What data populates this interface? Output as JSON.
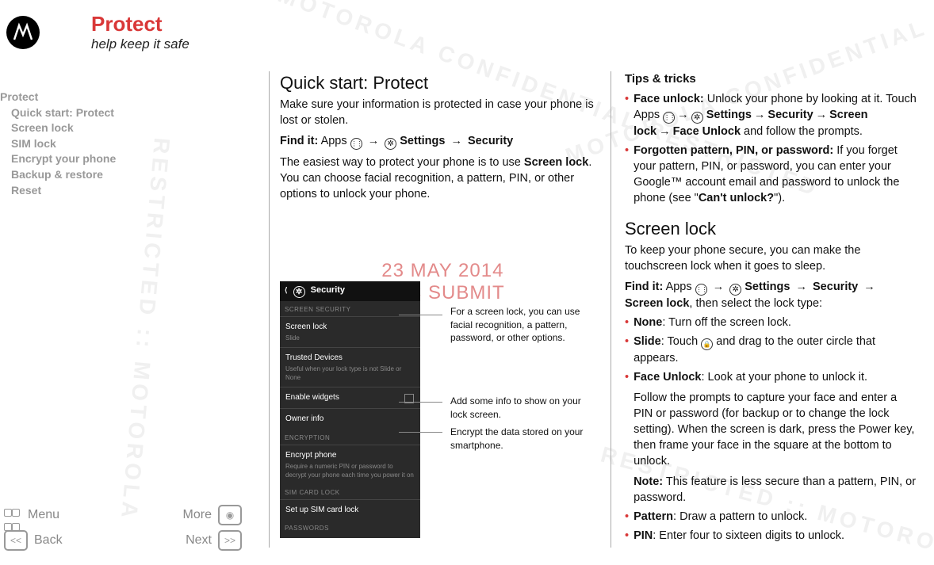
{
  "header": {
    "title": "Protect",
    "subtitle": "help keep it safe"
  },
  "toc": {
    "top": "Protect",
    "items": [
      "Quick start: Protect",
      "Screen lock",
      "SIM lock",
      "Encrypt your phone",
      "Backup & restore",
      "Reset"
    ]
  },
  "col1": {
    "heading": "Quick start: Protect",
    "intro": "Make sure your information is protected in case your phone is lost or stolen.",
    "findit_label": "Find it:",
    "findit_apps": "Apps",
    "findit_settings": "Settings",
    "findit_security": "Security",
    "body": "The easiest way to protect your phone is to use ",
    "screenlock_bold": "Screen lock",
    "body2": ". You can choose facial recognition, a pattern, PIN, or other options to unlock your phone."
  },
  "phone": {
    "title": "Security",
    "sec1": "SCREEN SECURITY",
    "item1": "Screen lock",
    "item1sub": "Slide",
    "item2": "Trusted Devices",
    "item2sub": "Useful when your lock type is not Slide or None",
    "item3": "Enable widgets",
    "item4": "Owner info",
    "sec2": "ENCRYPTION",
    "item5": "Encrypt phone",
    "item5sub": "Require a numeric PIN or password to decrypt your phone each time you power it on",
    "sec3": "SIM CARD LOCK",
    "item6": "Set up SIM card lock",
    "sec4": "PASSWORDS"
  },
  "callouts": {
    "c1": "For a screen lock, you can use facial recognition, a pattern, password, or other options.",
    "c2": "Add some info to show on your lock screen.",
    "c3": "Encrypt the data stored on your smartphone."
  },
  "col2": {
    "tips_heading": "Tips & tricks",
    "tip1_bold": "Face unlock:",
    "tip1": " Unlock your phone by looking at it. Touch Apps ",
    "tip1_settings": "Settings",
    "tip1_security": "Security",
    "tip1_screenlock": "Screen lock",
    "tip1_faceunlock": "Face Unlock",
    "tip1_end": " and follow the prompts.",
    "tip2_bold": "Forgotten pattern, PIN, or password:",
    "tip2": " If you forget your pattern, PIN, or password, you can enter your Google™ account email and password to unlock the phone (see \"",
    "tip2_link": "Can't unlock?",
    "tip2_end": "\").",
    "screenlock_heading": "Screen lock",
    "sl_intro": "To keep your phone secure, you can make the touchscreen lock when it goes to sleep.",
    "sl_findit_label": "Find it:",
    "sl_apps": "Apps",
    "sl_settings": "Settings",
    "sl_security": "Security",
    "sl_screenlock": "Screen lock",
    "sl_end": ", then select the lock type:",
    "b_none": "None",
    "b_none_t": ": Turn off the screen lock.",
    "b_slide": "Slide",
    "b_slide_t1": ": Touch ",
    "b_slide_t2": " and drag to the outer circle that appears.",
    "b_face": "Face Unlock",
    "b_face_t": ": Look at your phone to unlock it.",
    "b_face_p2": "Follow the prompts to capture your face and enter a PIN or password (for backup or to change the lock setting). When the screen is dark, press the Power key, then frame your face in the square at the bottom to unlock.",
    "b_face_note": "Note:",
    "b_face_note_t": " This feature is less secure than a pattern, PIN, or password.",
    "b_pattern": "Pattern",
    "b_pattern_t": ": Draw a pattern to unlock.",
    "b_pin": "PIN",
    "b_pin_t": ": Enter four to sixteen digits to unlock."
  },
  "nav": {
    "menu": "Menu",
    "more": "More",
    "back": "Back",
    "next": "Next"
  },
  "stamp": {
    "line1": "23 MAY 2014",
    "line2": "FCC SUBMIT"
  }
}
